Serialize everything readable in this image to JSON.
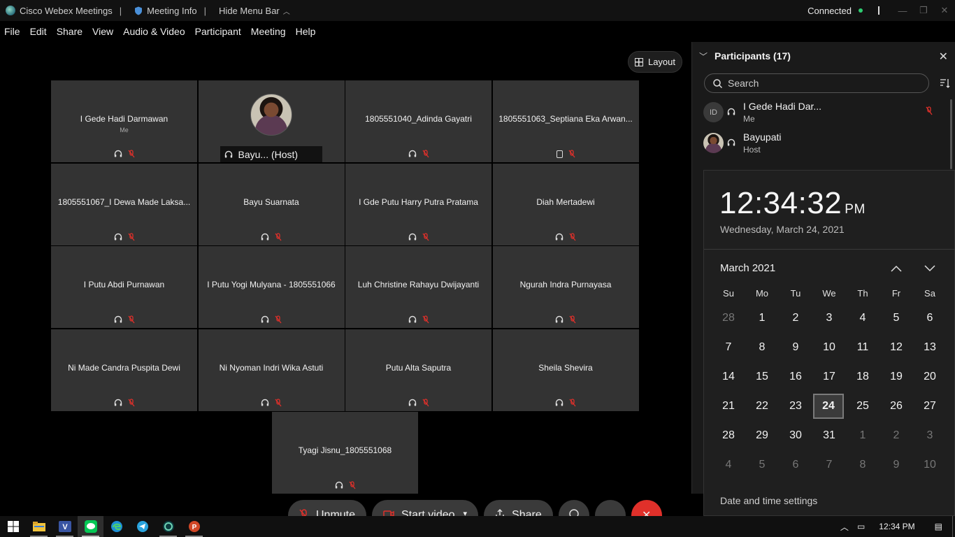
{
  "titlebar": {
    "app_name": "Cisco Webex Meetings",
    "meeting_info": "Meeting Info",
    "hide_menu": "Hide Menu Bar",
    "status": "Connected"
  },
  "menu": [
    "File",
    "Edit",
    "Share",
    "View",
    "Audio & Video",
    "Participant",
    "Meeting",
    "Help"
  ],
  "layout_button": "Layout",
  "tiles": [
    {
      "name": "I Gede Hadi Darmawan",
      "sub": "Me",
      "device": "audio"
    },
    {
      "name": "Bayu...  (Host)",
      "sub": "",
      "device": "host"
    },
    {
      "name": "1805551040_Adinda Gayatri",
      "sub": "",
      "device": "audio"
    },
    {
      "name": "1805551063_Septiana Eka Arwan...",
      "sub": "",
      "device": "phone"
    },
    {
      "name": "1805551067_I Dewa Made Laksa...",
      "sub": "",
      "device": "audio"
    },
    {
      "name": "Bayu Suarnata",
      "sub": "",
      "device": "audio"
    },
    {
      "name": "I Gde Putu Harry Putra Pratama",
      "sub": "",
      "device": "audio"
    },
    {
      "name": "Diah Mertadewi",
      "sub": "",
      "device": "audio"
    },
    {
      "name": "I Putu Abdi Purnawan",
      "sub": "",
      "device": "audio"
    },
    {
      "name": "I Putu Yogi Mulyana - 1805551066",
      "sub": "",
      "device": "audio"
    },
    {
      "name": "Luh Christine Rahayu Dwijayanti",
      "sub": "",
      "device": "audio"
    },
    {
      "name": "Ngurah Indra Purnayasa",
      "sub": "",
      "device": "audio"
    },
    {
      "name": "Ni Made Candra Puspita Dewi",
      "sub": "",
      "device": "audio"
    },
    {
      "name": "Ni Nyoman Indri Wika Astuti",
      "sub": "",
      "device": "audio"
    },
    {
      "name": "Putu Alta Saputra",
      "sub": "",
      "device": "audio"
    },
    {
      "name": "Sheila Shevira",
      "sub": "",
      "device": "audio"
    },
    {
      "name": "Tyagi Jisnu_1805551068",
      "sub": "",
      "device": "audio"
    }
  ],
  "controls": {
    "unmute": "Unmute",
    "start_video": "Start video",
    "share": "Share"
  },
  "participants_panel": {
    "title": "Participants (17)",
    "search_placeholder": "Search",
    "list": [
      {
        "initials": "ID",
        "name": "I Gede Hadi Dar...",
        "role": "Me"
      },
      {
        "initials": "",
        "name": "Bayupati",
        "role": "Host"
      }
    ]
  },
  "clock": {
    "time": "12:34:32",
    "ampm": "PM",
    "date": "Wednesday, March 24, 2021",
    "month": "March 2021",
    "weekdays": [
      "Su",
      "Mo",
      "Tu",
      "We",
      "Th",
      "Fr",
      "Sa"
    ],
    "days": [
      "28",
      "1",
      "2",
      "3",
      "4",
      "5",
      "6",
      "7",
      "8",
      "9",
      "10",
      "11",
      "12",
      "13",
      "14",
      "15",
      "16",
      "17",
      "18",
      "19",
      "20",
      "21",
      "22",
      "23",
      "24",
      "25",
      "26",
      "27",
      "28",
      "29",
      "30",
      "31",
      "1",
      "2",
      "3",
      "4",
      "5",
      "6",
      "7",
      "8",
      "9",
      "10"
    ],
    "first_current_index": 1,
    "last_current_index": 31,
    "today_index": 24,
    "settings_link": "Date and time settings"
  },
  "taskbar": {
    "time": "12:34 PM",
    "apps": [
      "start-icon",
      "file-explorer-icon",
      "visio-icon",
      "line-icon",
      "edge-icon",
      "telegram-icon",
      "webex-icon",
      "powerpoint-icon"
    ]
  }
}
